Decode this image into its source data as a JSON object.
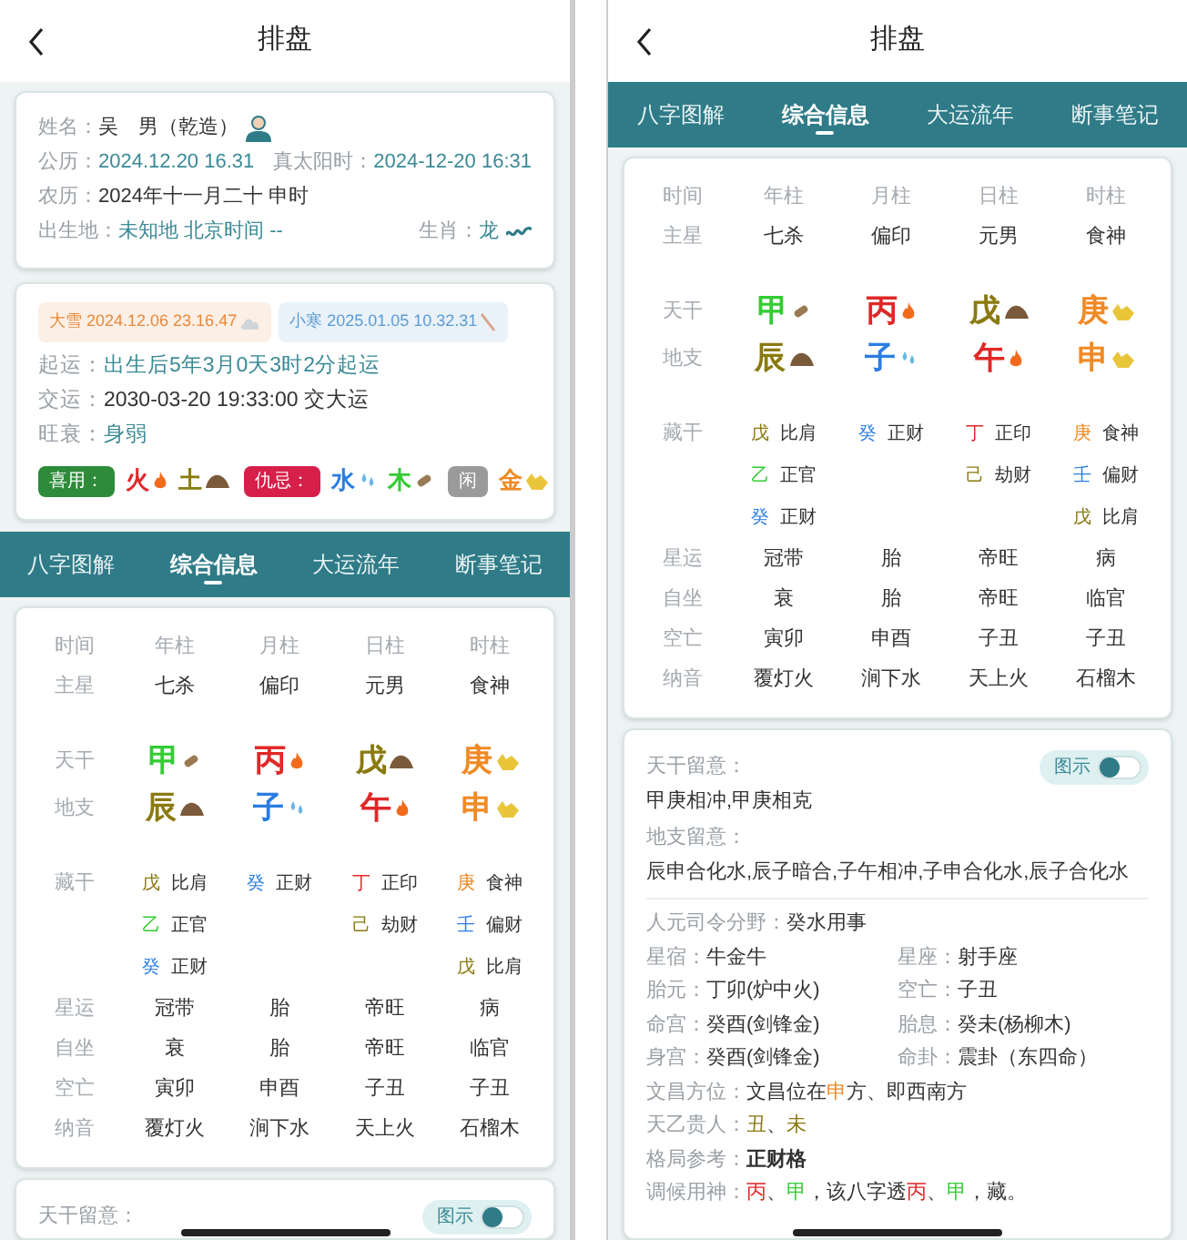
{
  "screens": [
    {
      "title": "排盘",
      "sections": [
        {
          "kind": "profile",
          "rows": [
            {
              "items": [
                {
                  "label": "姓名：",
                  "value": "吴　男（乾造）",
                  "accent": false,
                  "kind": "name"
                }
              ]
            },
            {
              "items": [
                {
                  "label": "公历：",
                  "value": "2024.12.20 16.31",
                  "accent": true,
                  "kind": "field"
                },
                {
                  "label": "真太阳时：",
                  "value": "2024-12-20 16:31",
                  "accent": true,
                  "kind": "field"
                }
              ]
            },
            {
              "items": [
                {
                  "label": "农历：",
                  "value": "2024年十一月二十 申时",
                  "accent": false,
                  "kind": "field"
                }
              ]
            },
            {
              "items": [
                {
                  "label": "出生地：",
                  "value": "未知地 北京时间 --",
                  "accent": true,
                  "kind": "field"
                },
                {
                  "label": "生肖：",
                  "value": "龙",
                  "accent": true,
                  "kind": "zodiac"
                }
              ]
            }
          ]
        },
        {
          "kind": "terms",
          "terms": [
            {
              "text": "大雪 2024.12.06 23.16.47",
              "color": "#e8893a",
              "kind": "cloud"
            },
            {
              "text": "小寒 2025.01.05 10.32.31",
              "color": "#5b9bd5",
              "kind": "brush"
            }
          ],
          "rows": [
            {
              "items": [
                {
                  "label": "起运：",
                  "value": "出生后5年3月0天3时2分起运",
                  "accent": true,
                  "kind": "field"
                }
              ]
            },
            {
              "items": [
                {
                  "label": "交运：",
                  "value": "2030-03-20 19:33:00 交大运",
                  "accent": false,
                  "kind": "field"
                }
              ]
            },
            {
              "items": [
                {
                  "label": "旺衰：",
                  "value": "身弱",
                  "accent": true,
                  "kind": "field"
                }
              ]
            }
          ],
          "groups": [
            {
              "tag": "喜用：",
              "color": "#2e8b3a",
              "items": [
                {
                  "char": "火",
                  "color": "#e02828",
                  "kind": "fire"
                },
                {
                  "char": "土",
                  "color": "#8a7a10",
                  "kind": "earth"
                }
              ]
            },
            {
              "tag": "仇忌：",
              "color": "#d6204a",
              "items": [
                {
                  "char": "水",
                  "color": "#2a7de1",
                  "kind": "water"
                },
                {
                  "char": "木",
                  "color": "#33cc33",
                  "kind": "wood"
                }
              ]
            },
            {
              "tag": "闲",
              "color": "#9a9a9a",
              "items": [
                {
                  "char": "金",
                  "color": "#f08a24",
                  "kind": "metal"
                }
              ]
            }
          ]
        },
        {
          "kind": "tabs",
          "tabs": [
            {
              "label": "八字图解",
              "selected": false
            },
            {
              "label": "综合信息",
              "selected": true
            },
            {
              "label": "大运流年",
              "selected": false
            },
            {
              "label": "断事笔记",
              "selected": false
            }
          ]
        },
        {
          "kind": "pillars",
          "corner": "时间",
          "columns": [
            "年柱",
            "月柱",
            "日柱",
            "时柱"
          ],
          "rows": [
            {
              "kind": "text",
              "label": "主星",
              "cells": [
                "七杀",
                "偏印",
                "元男",
                "食神"
              ]
            },
            {
              "kind": "stem",
              "label": "天干",
              "cells": [
                {
                  "char": "甲",
                  "color": "#33cc33",
                  "kind": "wood"
                },
                {
                  "char": "丙",
                  "color": "#e02828",
                  "kind": "fire"
                },
                {
                  "char": "戊",
                  "color": "#8a7a10",
                  "kind": "earth"
                },
                {
                  "char": "庚",
                  "color": "#f08a24",
                  "kind": "metal"
                }
              ]
            },
            {
              "kind": "stem",
              "label": "地支",
              "cells": [
                {
                  "char": "辰",
                  "color": "#8a7a10",
                  "kind": "earth"
                },
                {
                  "char": "子",
                  "color": "#2a7de1",
                  "kind": "water"
                },
                {
                  "char": "午",
                  "color": "#e02828",
                  "kind": "fire"
                },
                {
                  "char": "申",
                  "color": "#f08a24",
                  "kind": "metal"
                }
              ]
            },
            {
              "kind": "hidden",
              "label": "藏干",
              "cells": [
                [
                  {
                    "char": "戊",
                    "color": "#8a7a10",
                    "god": "比肩"
                  },
                  {
                    "char": "乙",
                    "color": "#33cc33",
                    "god": "正官"
                  },
                  {
                    "char": "癸",
                    "color": "#2a7de1",
                    "god": "正财"
                  }
                ],
                [
                  {
                    "char": "癸",
                    "color": "#2a7de1",
                    "god": "正财"
                  }
                ],
                [
                  {
                    "char": "丁",
                    "color": "#e02828",
                    "god": "正印"
                  },
                  {
                    "char": "己",
                    "color": "#8a7a10",
                    "god": "劫财"
                  }
                ],
                [
                  {
                    "char": "庚",
                    "color": "#f08a24",
                    "god": "食神"
                  },
                  {
                    "char": "壬",
                    "color": "#2a7de1",
                    "god": "偏财"
                  },
                  {
                    "char": "戊",
                    "color": "#8a7a10",
                    "god": "比肩"
                  }
                ]
              ]
            },
            {
              "kind": "text",
              "label": "星运",
              "cells": [
                "冠带",
                "胎",
                "帝旺",
                "病"
              ]
            },
            {
              "kind": "text",
              "label": "自坐",
              "cells": [
                "衰",
                "胎",
                "帝旺",
                "临官"
              ]
            },
            {
              "kind": "text",
              "label": "空亡",
              "cells": [
                "寅卯",
                "申酉",
                "子丑",
                "子丑"
              ]
            },
            {
              "kind": "text",
              "label": "纳音",
              "cells": [
                "覆灯火",
                "涧下水",
                "天上火",
                "石榴木"
              ]
            }
          ]
        },
        {
          "kind": "notes",
          "toggle": {
            "label": "图示",
            "on": false
          },
          "items": [
            {
              "label": "天干留意："
            }
          ]
        }
      ]
    },
    {
      "title": "排盘",
      "sections": [
        {
          "kind": "tabs",
          "tabs": [
            {
              "label": "八字图解",
              "selected": false
            },
            {
              "label": "综合信息",
              "selected": true
            },
            {
              "label": "大运流年",
              "selected": false
            },
            {
              "label": "断事笔记",
              "selected": false
            }
          ]
        },
        {
          "kind": "pillars",
          "corner": "时间",
          "columns": [
            "年柱",
            "月柱",
            "日柱",
            "时柱"
          ],
          "rows": [
            {
              "kind": "text",
              "label": "主星",
              "cells": [
                "七杀",
                "偏印",
                "元男",
                "食神"
              ]
            },
            {
              "kind": "stem",
              "label": "天干",
              "cells": [
                {
                  "char": "甲",
                  "color": "#33cc33",
                  "kind": "wood"
                },
                {
                  "char": "丙",
                  "color": "#e02828",
                  "kind": "fire"
                },
                {
                  "char": "戊",
                  "color": "#8a7a10",
                  "kind": "earth"
                },
                {
                  "char": "庚",
                  "color": "#f08a24",
                  "kind": "metal"
                }
              ]
            },
            {
              "kind": "stem",
              "label": "地支",
              "cells": [
                {
                  "char": "辰",
                  "color": "#8a7a10",
                  "kind": "earth"
                },
                {
                  "char": "子",
                  "color": "#2a7de1",
                  "kind": "water"
                },
                {
                  "char": "午",
                  "color": "#e02828",
                  "kind": "fire"
                },
                {
                  "char": "申",
                  "color": "#f08a24",
                  "kind": "metal"
                }
              ]
            },
            {
              "kind": "hidden",
              "label": "藏干",
              "cells": [
                [
                  {
                    "char": "戊",
                    "color": "#8a7a10",
                    "god": "比肩"
                  },
                  {
                    "char": "乙",
                    "color": "#33cc33",
                    "god": "正官"
                  },
                  {
                    "char": "癸",
                    "color": "#2a7de1",
                    "god": "正财"
                  }
                ],
                [
                  {
                    "char": "癸",
                    "color": "#2a7de1",
                    "god": "正财"
                  }
                ],
                [
                  {
                    "char": "丁",
                    "color": "#e02828",
                    "god": "正印"
                  },
                  {
                    "char": "己",
                    "color": "#8a7a10",
                    "god": "劫财"
                  }
                ],
                [
                  {
                    "char": "庚",
                    "color": "#f08a24",
                    "god": "食神"
                  },
                  {
                    "char": "壬",
                    "color": "#2a7de1",
                    "god": "偏财"
                  },
                  {
                    "char": "戊",
                    "color": "#8a7a10",
                    "god": "比肩"
                  }
                ]
              ]
            },
            {
              "kind": "text",
              "label": "星运",
              "cells": [
                "冠带",
                "胎",
                "帝旺",
                "病"
              ]
            },
            {
              "kind": "text",
              "label": "自坐",
              "cells": [
                "衰",
                "胎",
                "帝旺",
                "临官"
              ]
            },
            {
              "kind": "text",
              "label": "空亡",
              "cells": [
                "寅卯",
                "申酉",
                "子丑",
                "子丑"
              ]
            },
            {
              "kind": "text",
              "label": "纳音",
              "cells": [
                "覆灯火",
                "涧下水",
                "天上火",
                "石榴木"
              ]
            }
          ]
        },
        {
          "kind": "notes",
          "toggle": {
            "label": "图示",
            "on": false
          },
          "items": [
            {
              "label": "天干留意：",
              "text": "甲庚相冲,甲庚相克"
            },
            {
              "label": "地支留意：",
              "text": "辰申合化水,辰子暗合,子午相冲,子申合化水,辰子合化水"
            }
          ],
          "details": [
            {
              "kind": "single",
              "label": "人元司令分野：",
              "value": [
                {
                  "text": "癸水用事"
                }
              ]
            },
            {
              "kind": "pair",
              "items": [
                {
                  "label": "星宿：",
                  "value": "牛金牛"
                },
                {
                  "label": "星座：",
                  "value": "射手座"
                }
              ]
            },
            {
              "kind": "pair",
              "items": [
                {
                  "label": "胎元：",
                  "value": "丁卯(炉中火)"
                },
                {
                  "label": "空亡：",
                  "value": "子丑"
                }
              ]
            },
            {
              "kind": "pair",
              "items": [
                {
                  "label": "命宫：",
                  "value": "癸酉(剑锋金)"
                },
                {
                  "label": "胎息：",
                  "value": "癸未(杨柳木)"
                }
              ]
            },
            {
              "kind": "pair",
              "items": [
                {
                  "label": "身宫：",
                  "value": "癸酉(剑锋金)"
                },
                {
                  "label": "命卦：",
                  "value": "震卦（东四命）"
                }
              ]
            },
            {
              "kind": "single",
              "label": "文昌方位：",
              "value": [
                {
                  "text": "文昌位在"
                },
                {
                  "text": "申",
                  "color": "#f08a24"
                },
                {
                  "text": "方、即西南方"
                }
              ]
            },
            {
              "kind": "single",
              "label": "天乙贵人：",
              "value": [
                {
                  "text": "丑",
                  "color": "#8a7a10"
                },
                {
                  "text": "、"
                },
                {
                  "text": "未",
                  "color": "#8a7a10"
                }
              ]
            },
            {
              "kind": "strong",
              "label": "格局参考：",
              "value": [
                {
                  "text": "正财格"
                }
              ]
            },
            {
              "kind": "single",
              "label": "调候用神：",
              "value": [
                {
                  "text": "丙",
                  "color": "#e02828"
                },
                {
                  "text": "、"
                },
                {
                  "text": "甲",
                  "color": "#33cc33"
                },
                {
                  "text": "，该八字透"
                },
                {
                  "text": "丙",
                  "color": "#e02828"
                },
                {
                  "text": "、"
                },
                {
                  "text": "甲",
                  "color": "#33cc33"
                },
                {
                  "text": "，藏。"
                }
              ]
            }
          ]
        }
      ]
    }
  ]
}
